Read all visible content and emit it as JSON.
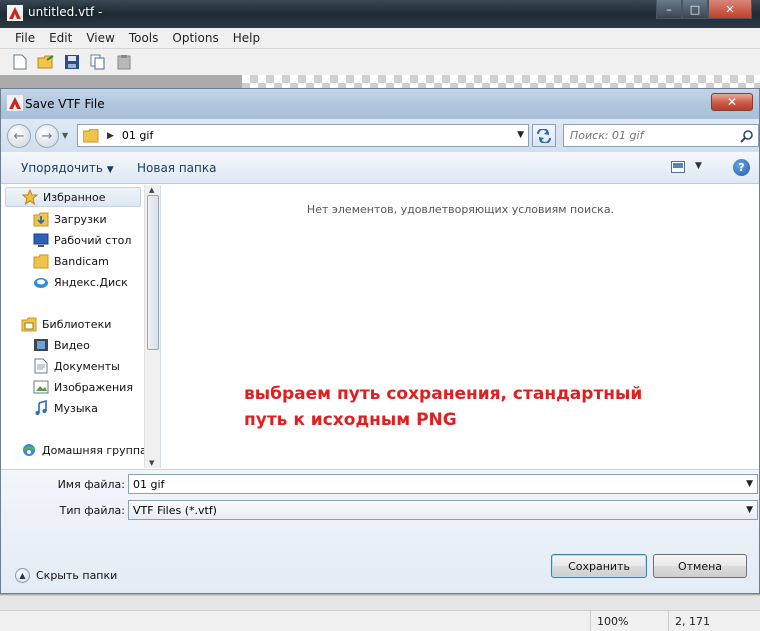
{
  "app": {
    "title": "untitled.vtf -",
    "menu": [
      "File",
      "Edit",
      "View",
      "Tools",
      "Options",
      "Help"
    ],
    "toolbar_icons": [
      "new-file-icon",
      "open-folder-icon",
      "save-icon",
      "copy-icon",
      "paste-icon"
    ],
    "window_buttons": {
      "minimize": "–",
      "maximize": "□",
      "close": "✕"
    }
  },
  "dialog": {
    "title": "Save VTF File",
    "close_glyph": "✕",
    "address": {
      "separator": "▶",
      "path": "01 gif"
    },
    "search": {
      "placeholder": "Поиск: 01 gif"
    },
    "commands": {
      "organize": "Упорядочить",
      "new_folder": "Новая папка",
      "help": "?"
    },
    "nav": {
      "items": [
        {
          "label": "Избранное",
          "icon": "star-icon"
        },
        {
          "label": "Загрузки",
          "icon": "downloads-folder-icon"
        },
        {
          "label": "Рабочий стол",
          "icon": "desktop-icon"
        },
        {
          "label": "Bandicam",
          "icon": "folder-icon"
        },
        {
          "label": "Яндекс.Диск",
          "icon": "yandex-disk-icon"
        },
        {
          "label": "Библиотеки",
          "icon": "libraries-icon"
        },
        {
          "label": "Видео",
          "icon": "video-icon"
        },
        {
          "label": "Документы",
          "icon": "documents-icon"
        },
        {
          "label": "Изображения",
          "icon": "pictures-icon"
        },
        {
          "label": "Музыка",
          "icon": "music-icon"
        },
        {
          "label": "Домашняя группа",
          "icon": "homegroup-icon"
        }
      ]
    },
    "content": {
      "empty_message": "Нет элементов, удовлетворяющих условиям поиска.",
      "annotation_line1": "выбраем путь сохранения, стандартный",
      "annotation_line2": "путь к исходным PNG",
      "annotation_color": "#e02020"
    },
    "filename": {
      "label": "Имя файла:",
      "value": "01 gif"
    },
    "filetype": {
      "label": "Тип файла:",
      "value": "VTF Files (*.vtf)"
    },
    "hide_folders": "Скрыть папки",
    "buttons": {
      "save": "Сохранить",
      "cancel": "Отмена"
    }
  },
  "status": {
    "zoom": "100%",
    "coords": "2, 171"
  }
}
